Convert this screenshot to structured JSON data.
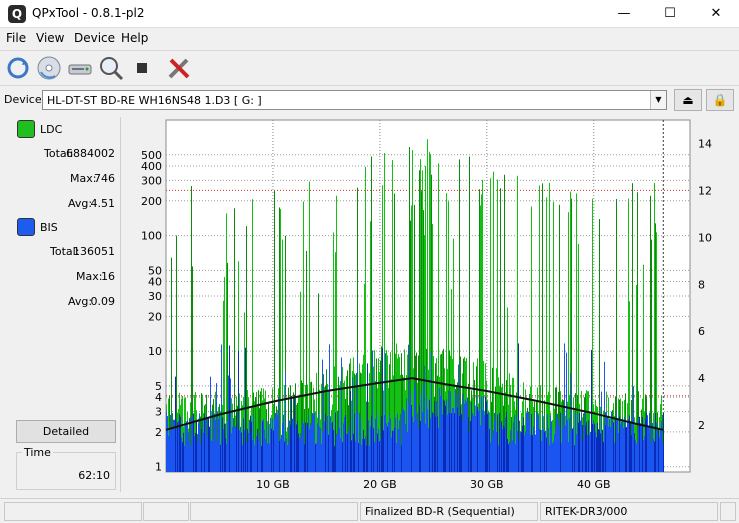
{
  "window": {
    "title": "QPxTool - 0.8.1-pl2",
    "minimize": "—",
    "maximize": "☐",
    "close": "✕",
    "app_icon": "Q"
  },
  "menu": [
    "File",
    "View",
    "Device",
    "Help"
  ],
  "toolbar": {
    "icons": [
      "refresh-icon",
      "disc-icon",
      "drive-icon",
      "scan-icon",
      "stop-icon",
      "tools-icon"
    ]
  },
  "device": {
    "label": "Device:",
    "value": "HL-DT-ST BD-RE  WH16NS48  1.D3 [ G: ]",
    "eject_symbol": "⏏",
    "lock_symbol": "🔒"
  },
  "stats": {
    "ldc": {
      "name": "LDC",
      "color": "#1fbf1f",
      "total_label": "Total:",
      "total": "6884002",
      "max_label": "Max:",
      "max": "746",
      "avg_label": "Avg:",
      "avg": "4.51"
    },
    "bis": {
      "name": "BIS",
      "color": "#1e5cf0",
      "total_label": "Total:",
      "total": "136051",
      "max_label": "Max:",
      "max": "16",
      "avg_label": "Avg:",
      "avg": "0.09"
    }
  },
  "detailed_label": "Detailed",
  "time": {
    "label": "Time",
    "value": "62:10"
  },
  "chart_data": {
    "type": "bar",
    "x_tick_labels": [
      "10 GB",
      "20 GB",
      "30 GB",
      "40 GB"
    ],
    "x_ticks": [
      10,
      20,
      30,
      40
    ],
    "xlim": [
      0,
      49
    ],
    "data_end_gb": 46.5,
    "y_left_log": true,
    "y_left_ticks": [
      1,
      2,
      3,
      4,
      5,
      10,
      20,
      30,
      40,
      50,
      100,
      200,
      300,
      400,
      500
    ],
    "ylim_left": [
      0.9,
      1000
    ],
    "y_right_ticks": [
      2,
      4,
      6,
      8,
      10,
      12,
      14
    ],
    "ylim_right": [
      0,
      15
    ],
    "red_hlines_right": [
      3.25,
      12.0
    ],
    "series": [
      {
        "name": "LDC",
        "color": "#11bb11"
      },
      {
        "name": "BIS",
        "color": "#1848f0"
      },
      {
        "name": "Speed",
        "color": "#111111",
        "x": [
          0,
          5,
          10,
          15,
          20,
          23,
          26,
          30,
          35,
          40,
          44,
          46.5
        ],
        "y": [
          1.8,
          2.45,
          3.0,
          3.45,
          3.8,
          4.0,
          3.75,
          3.45,
          3.0,
          2.5,
          2.05,
          1.8
        ]
      }
    ]
  },
  "statusbar": [
    "",
    "",
    "",
    "Finalized BD-R (Sequential)",
    "RITEK-DR3/000",
    ""
  ]
}
